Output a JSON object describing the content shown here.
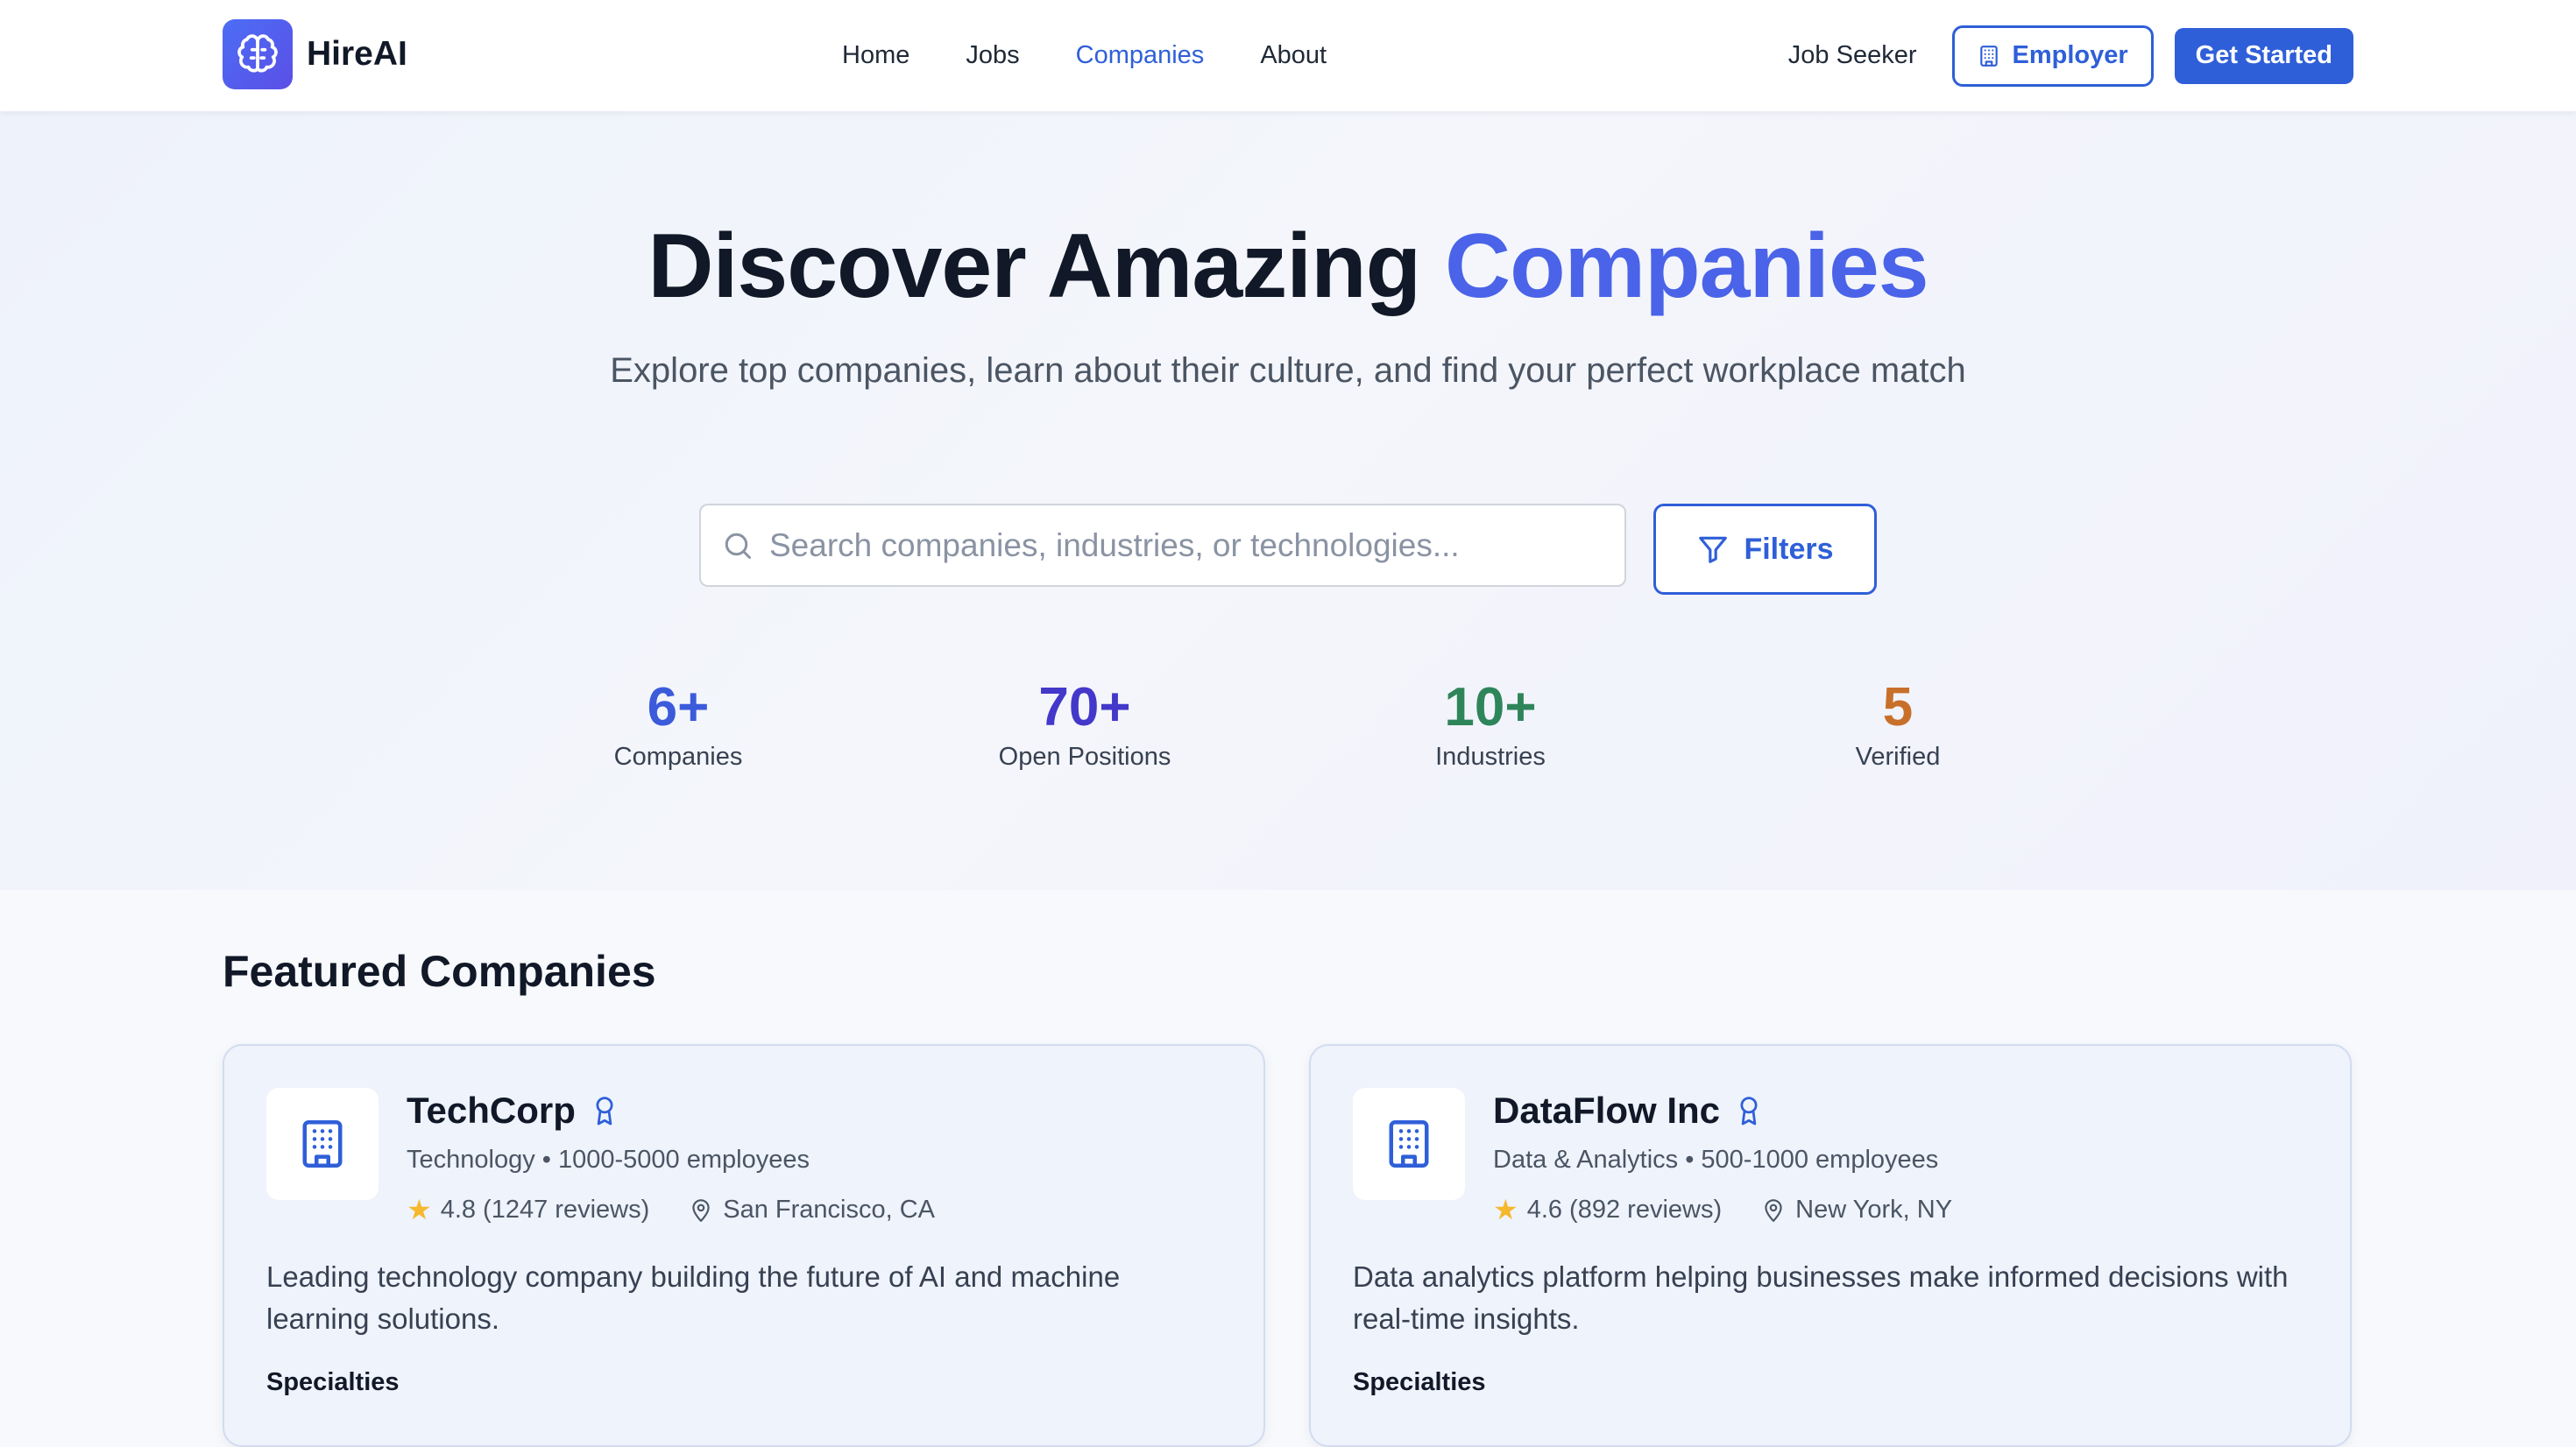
{
  "header": {
    "logo_text": "HireAI",
    "nav": [
      "Home",
      "Jobs",
      "Companies",
      "About"
    ],
    "active_nav": "Companies",
    "job_seeker_label": "Job Seeker",
    "employer_label": "Employer",
    "get_started_label": "Get Started"
  },
  "hero": {
    "title_prefix": "Discover Amazing",
    "title_accent": "Companies",
    "subtitle": "Explore top companies, learn about their culture, and find your perfect workplace match",
    "search_placeholder": "Search companies, industries, or technologies...",
    "filters_label": "Filters",
    "stats": [
      {
        "value": "6+",
        "label": "Companies",
        "color": "#3b5bdb"
      },
      {
        "value": "70+",
        "label": "Open Positions",
        "color": "#4338ca"
      },
      {
        "value": "10+",
        "label": "Industries",
        "color": "#2f855a"
      },
      {
        "value": "5",
        "label": "Verified",
        "color": "#c8702a"
      }
    ]
  },
  "featured": {
    "title": "Featured Companies",
    "companies": [
      {
        "name": "TechCorp",
        "meta": "Technology • 1000-5000 employees",
        "rating": "4.8 (1247 reviews)",
        "location": "San Francisco, CA",
        "description": "Leading technology company building the future of AI and machine learning solutions.",
        "specialties_label": "Specialties"
      },
      {
        "name": "DataFlow Inc",
        "meta": "Data & Analytics • 500-1000 employees",
        "rating": "4.6 (892 reviews)",
        "location": "New York, NY",
        "description": "Data analytics platform helping businesses make informed decisions with real-time insights.",
        "specialties_label": "Specialties"
      }
    ]
  },
  "colors": {
    "brand": "#2f5fd8",
    "accent_title": "#4a63e8",
    "star": "#f5b82e"
  }
}
